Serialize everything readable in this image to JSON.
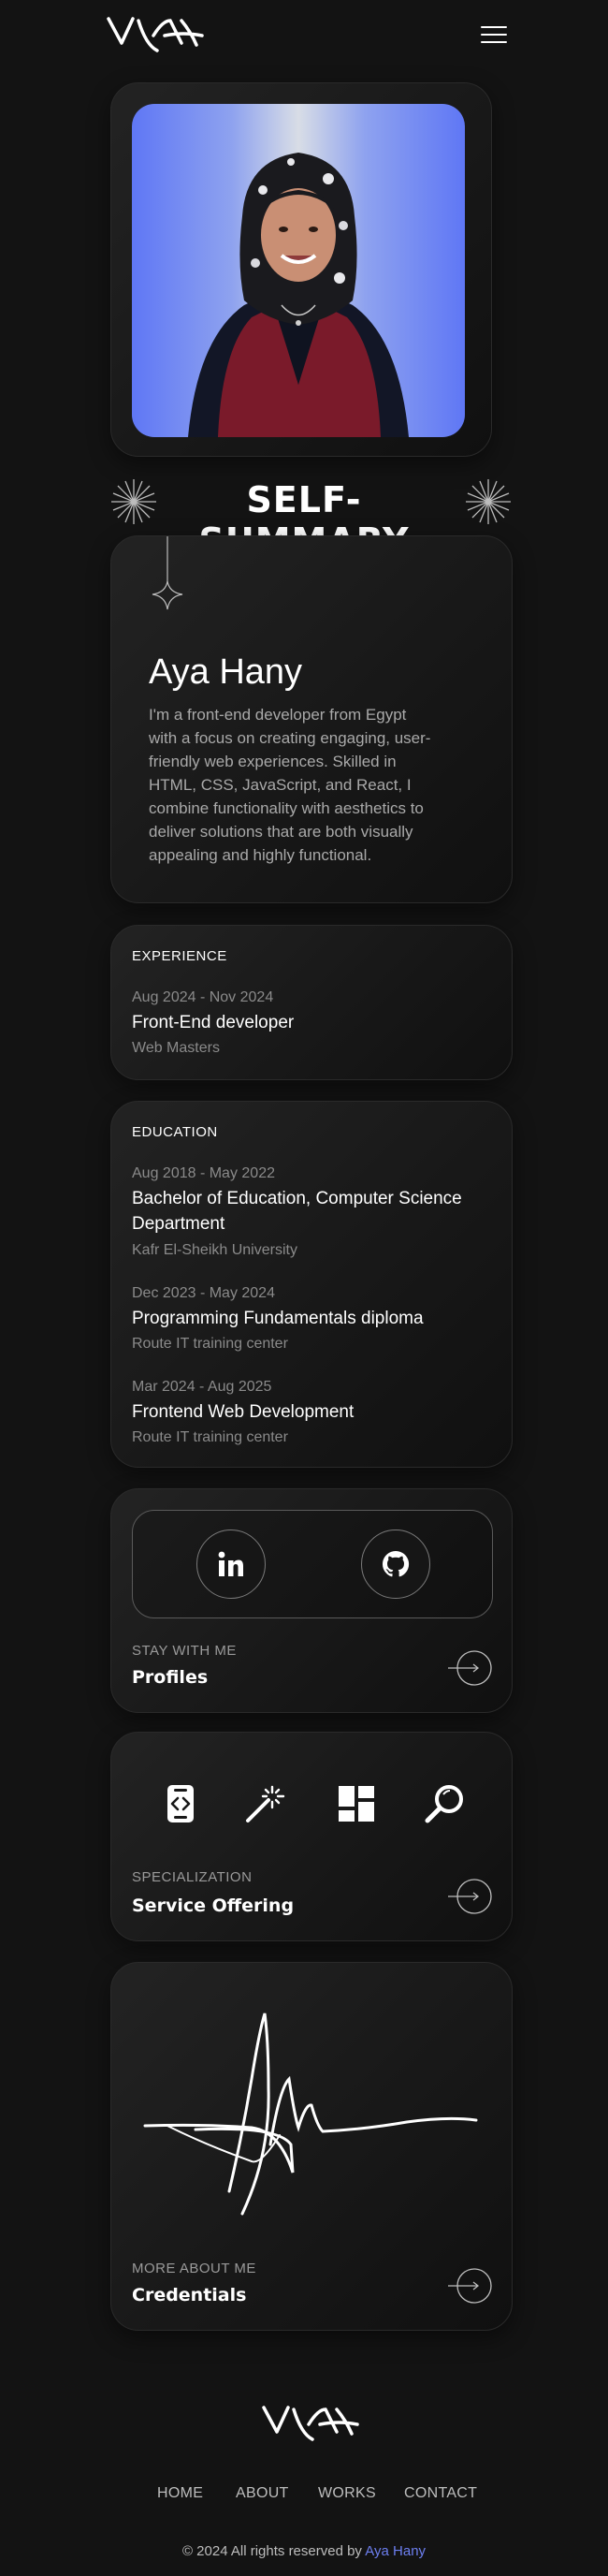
{
  "header": {
    "logo_icon": "aya-signature-logo",
    "menu_icon": "hamburger-menu-icon"
  },
  "summary": {
    "title": "SELF-SUMMARY",
    "name": "Aya Hany",
    "description": "I'm a front-end developer from Egypt with a focus on creating engaging, user-friendly web experiences. Skilled in HTML, CSS, JavaScript, and React, I combine functionality with aesthetics to deliver solutions that are both visually appealing and highly functional."
  },
  "experience": {
    "heading": "EXPERIENCE",
    "items": [
      {
        "date": "Aug 2024 - Nov 2024",
        "role": "Front-End developer",
        "place": "Web Masters"
      }
    ]
  },
  "education": {
    "heading": "EDUCATION",
    "items": [
      {
        "date": "Aug 2018 - May 2022",
        "role_line1": "Bachelor of Education, Computer Science",
        "role_line2": "Department",
        "place": "Kafr El-Sheikh University"
      },
      {
        "date": "Dec 2023 - May 2024",
        "role": "Programming Fundamentals diploma",
        "place": "Route IT training center"
      },
      {
        "date": "Mar 2024 - Aug 2025",
        "role": "Frontend Web Development",
        "place": "Route IT training center"
      }
    ]
  },
  "profiles": {
    "sub_label": "STAY WITH ME",
    "title": "Profiles",
    "links": [
      "linkedin-icon",
      "github-icon"
    ]
  },
  "services": {
    "sub_label": "SPECIALIZATION",
    "title": "Service Offering",
    "icons": [
      "code-device-icon",
      "magic-wand-icon",
      "dashboard-layout-icon",
      "search-magnifier-icon"
    ]
  },
  "credentials": {
    "sub_label": "MORE ABOUT ME",
    "title": "Credentials",
    "signature_icon": "ah-signature-icon"
  },
  "footer": {
    "nav": [
      "HOME",
      "ABOUT",
      "WORKS",
      "CONTACT"
    ],
    "copyright_prefix": "© 2024 All rights reserved by ",
    "copyright_name": "Aya Hany"
  },
  "colors": {
    "background": "#131313",
    "accent": "#6d7ff0",
    "photo_bg": "#5f77f5"
  }
}
